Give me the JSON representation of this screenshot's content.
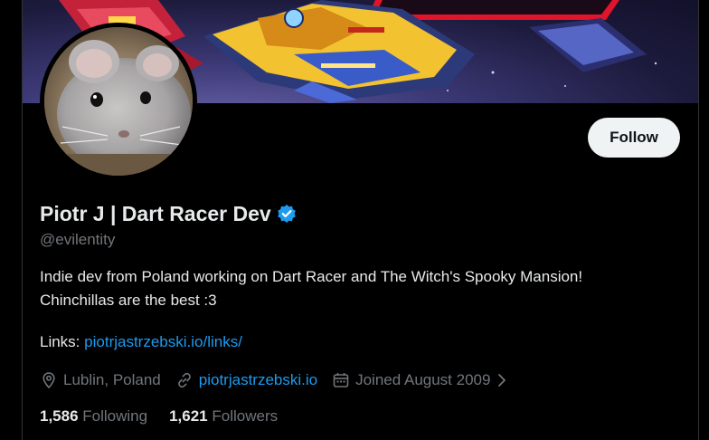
{
  "profile": {
    "display_name": "Piotr J | Dart Racer Dev",
    "handle": "@evilentity",
    "bio_line1": "Indie dev from Poland working on Dart Racer and The Witch's Spooky Mansion!",
    "bio_line2": "Chinchillas are the best :3",
    "links_label": "Links:",
    "links_url": "piotrjastrzebski.io/links/",
    "location": "Lublin, Poland",
    "website": "piotrjastrzebski.io",
    "joined": "Joined August 2009",
    "following_count": "1,586",
    "following_label": "Following",
    "followers_count": "1,621",
    "followers_label": "Followers"
  },
  "actions": {
    "follow_label": "Follow"
  },
  "colors": {
    "accent": "#1d9bf0",
    "background": "#000000",
    "muted": "#71767b",
    "text": "#e7e9ea",
    "follow_bg": "#eff3f4"
  },
  "icons": {
    "verified": "verified-badge-icon",
    "location": "location-pin-icon",
    "website": "link-icon",
    "joined": "calendar-icon",
    "chevron": "chevron-right-icon"
  }
}
